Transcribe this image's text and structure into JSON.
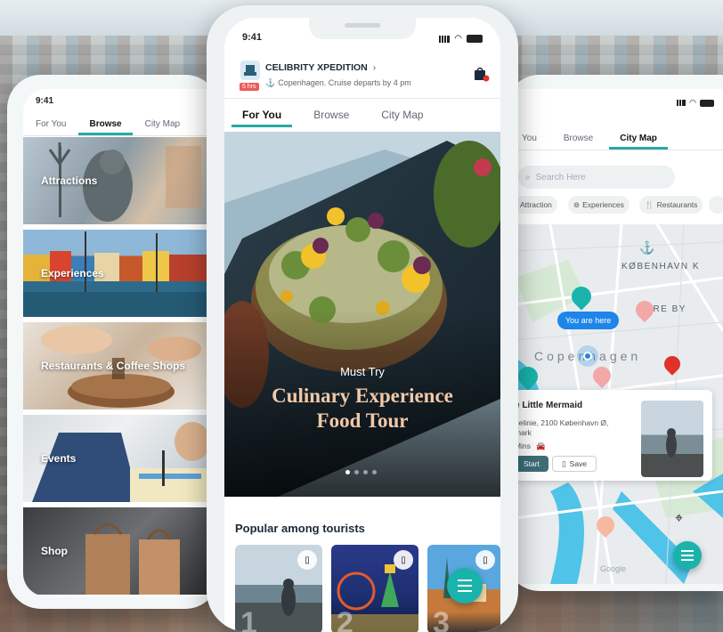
{
  "left_phone": {
    "time": "9:41",
    "tabs": [
      "For You",
      "Browse",
      "City Map"
    ],
    "active_tab": "Browse",
    "categories": [
      {
        "label": "Attractions"
      },
      {
        "label": "Experiences"
      },
      {
        "label": "Restaurants & Coffee Shops"
      },
      {
        "label": "Events"
      },
      {
        "label": "Shop"
      }
    ]
  },
  "center_phone": {
    "time": "9:41",
    "header": {
      "title": "CELIBRITY XPEDITION",
      "badge": "5 hrs",
      "subtitle": "Copenhagen. Cruise departs by 4 pm"
    },
    "tabs": [
      "For You",
      "Browse",
      "City Map"
    ],
    "active_tab": "For You",
    "hero": {
      "kicker": "Must Try",
      "title_line1": "Culinary Experience",
      "title_line2": "Food Tour"
    },
    "section_title": "Popular among tourists",
    "popular_ranks": [
      "1",
      "2",
      "3"
    ]
  },
  "right_phone": {
    "tabs": [
      "You",
      "Browse",
      "City Map"
    ],
    "active_tab": "City Map",
    "search_placeholder": "Search Here",
    "chips": [
      "Attraction",
      "Experiences",
      "Restaurants"
    ],
    "map": {
      "label_kobenhavn_k": "KØBENHAVN K",
      "label_indre_by": "NDRE BY",
      "label_city": "Copenhagen",
      "you_are_here": "You are here"
    },
    "place_card": {
      "name": "e Little Mermaid",
      "address_line1": "gelinie, 2100 København Ø,",
      "address_line2": "mark",
      "duration": "Mins",
      "start_label": "Start",
      "save_label": "Save"
    },
    "map_attribution": "Google"
  },
  "colors": {
    "accent": "#27a9a4",
    "fab": "#19b3ac",
    "pin_red": "#e0312b",
    "water": "#4fc3e8"
  }
}
